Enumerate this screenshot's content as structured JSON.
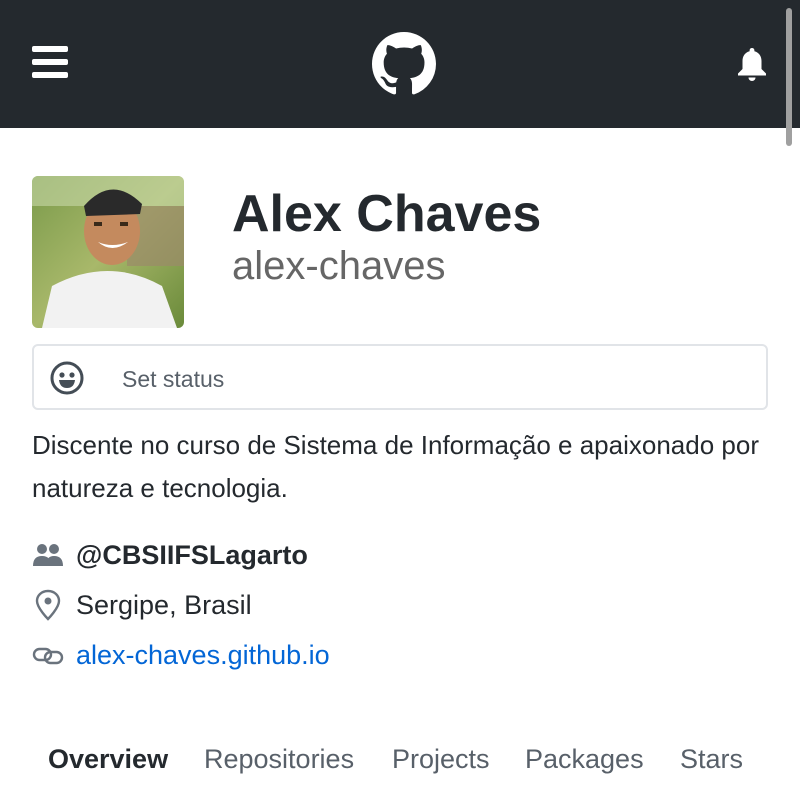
{
  "header": {
    "menu_icon": "hamburger-menu-icon",
    "logo_icon": "github-octocat-logo",
    "notification_icon": "bell-icon",
    "background_color": "#24292e"
  },
  "profile": {
    "name": "Alex Chaves",
    "username": "alex-chaves",
    "avatar_icon": "profile-photo"
  },
  "status": {
    "icon": "smiley-icon",
    "label": "Set status"
  },
  "bio": "Discente no curso de Sistema de Informação e apaixonado por natureza e tecnologia.",
  "details": {
    "organization": {
      "icon": "people-icon",
      "text": "@CBSIIFSLagarto"
    },
    "location": {
      "icon": "location-pin-icon",
      "text": "Sergipe, Brasil"
    },
    "website": {
      "icon": "link-icon",
      "text": "alex-chaves.github.io",
      "color": "#0366d6"
    }
  },
  "tabs": [
    {
      "label": "Overview",
      "active": true
    },
    {
      "label": "Repositories",
      "active": false
    },
    {
      "label": "Projects",
      "active": false
    },
    {
      "label": "Packages",
      "active": false
    },
    {
      "label": "Stars",
      "active": false
    }
  ]
}
